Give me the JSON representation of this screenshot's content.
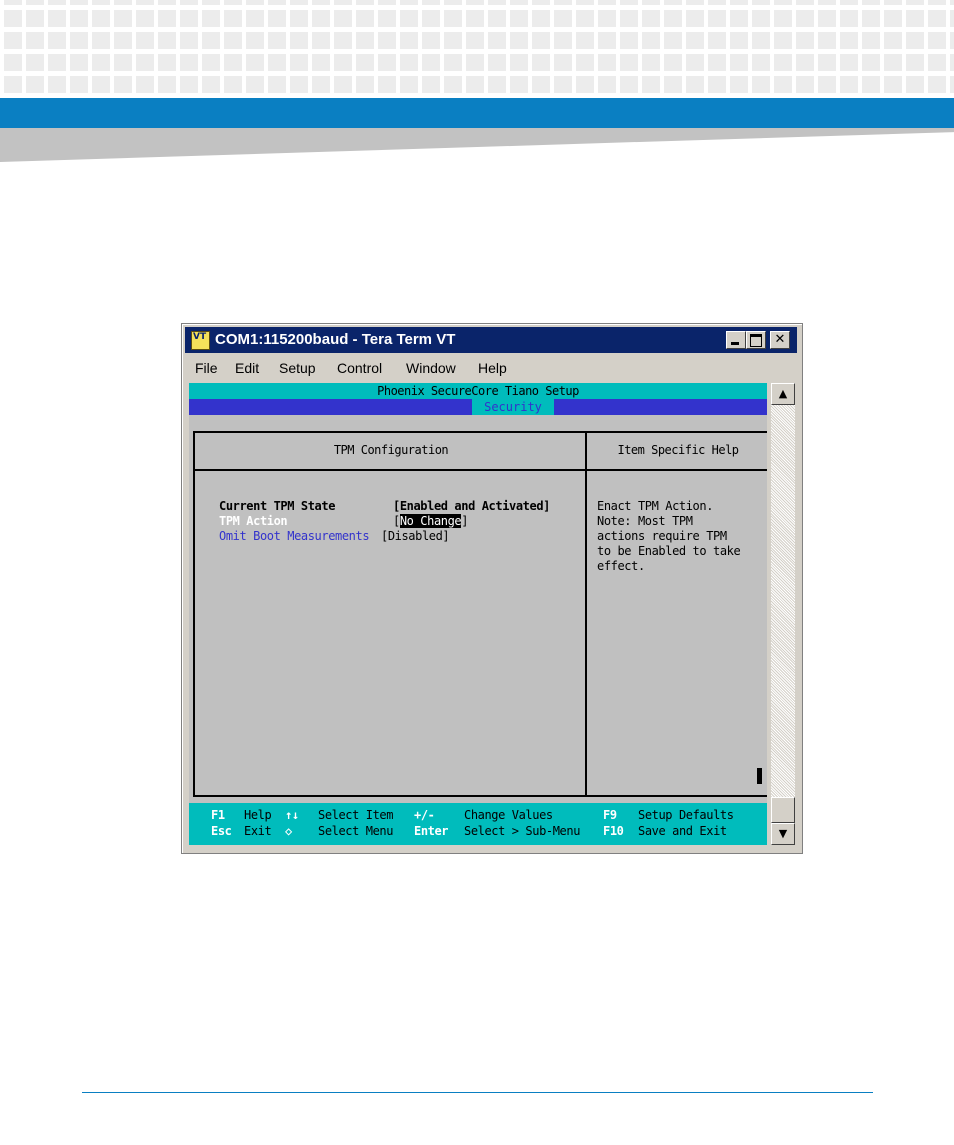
{
  "window": {
    "title": "COM1:115200baud - Tera Term VT",
    "icon_label": "VT",
    "icon": "teraterm-vt-icon",
    "controls": {
      "minimize_icon": "minimize-icon",
      "maximize_icon": "maximize-icon",
      "close_glyph": "✕"
    }
  },
  "menubar": {
    "items": [
      {
        "label": "File"
      },
      {
        "label": "Edit"
      },
      {
        "label": "Setup"
      },
      {
        "label": "Control"
      },
      {
        "label": "Window"
      },
      {
        "label": "Help"
      }
    ]
  },
  "bios": {
    "title": "Phoenix SecureCore Tiano Setup",
    "active_tab": "Security",
    "main_panel_title": "TPM Configuration",
    "help_panel_title": "Item Specific Help",
    "settings": [
      {
        "label": "Current TPM State",
        "value": "[Enabled and Activated]"
      },
      {
        "label": "TPM Action",
        "value_open": "[",
        "value_selected": "No Change",
        "value_close": "]"
      },
      {
        "label": "Omit Boot Measurements",
        "value": "[Disabled]"
      }
    ],
    "help_text": "Enact TPM Action.\nNote: Most TPM\nactions require TPM\nto be Enabled to take\neffect.",
    "footer": {
      "row1": [
        {
          "key": "F1",
          "desc": "Help"
        },
        {
          "key": "↑↓",
          "desc": "Select Item"
        },
        {
          "key": "+/-",
          "desc": "Change Values"
        },
        {
          "key": "F9",
          "desc": "Setup Defaults"
        }
      ],
      "row2": [
        {
          "key": "Esc",
          "desc": "Exit"
        },
        {
          "key": "◇",
          "desc": "Select Menu"
        },
        {
          "key": "Enter",
          "desc": "Select > Sub-Menu"
        },
        {
          "key": "F10",
          "desc": "Save and Exit"
        }
      ]
    }
  },
  "scrollbar": {
    "up_glyph": "▲",
    "down_glyph": "▼"
  },
  "colors": {
    "accent_blue": "#0a7fc2",
    "bios_cyan": "#00bcbc",
    "bios_blue": "#3333cc",
    "titlebar": "#0a246a"
  }
}
